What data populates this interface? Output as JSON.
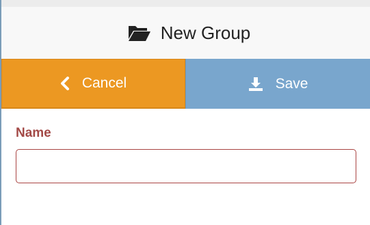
{
  "header": {
    "title": "New Group",
    "icon": "folder-open-icon"
  },
  "actions": {
    "cancel_label": "Cancel",
    "cancel_icon": "chevron-left-icon",
    "save_label": "Save",
    "save_icon": "download-icon"
  },
  "form": {
    "name_label": "Name",
    "name_value": "",
    "name_placeholder": ""
  },
  "colors": {
    "cancel": "#ec9822",
    "save": "#79a6cd",
    "error_label": "#a34a47",
    "error_border": "#a94442"
  }
}
